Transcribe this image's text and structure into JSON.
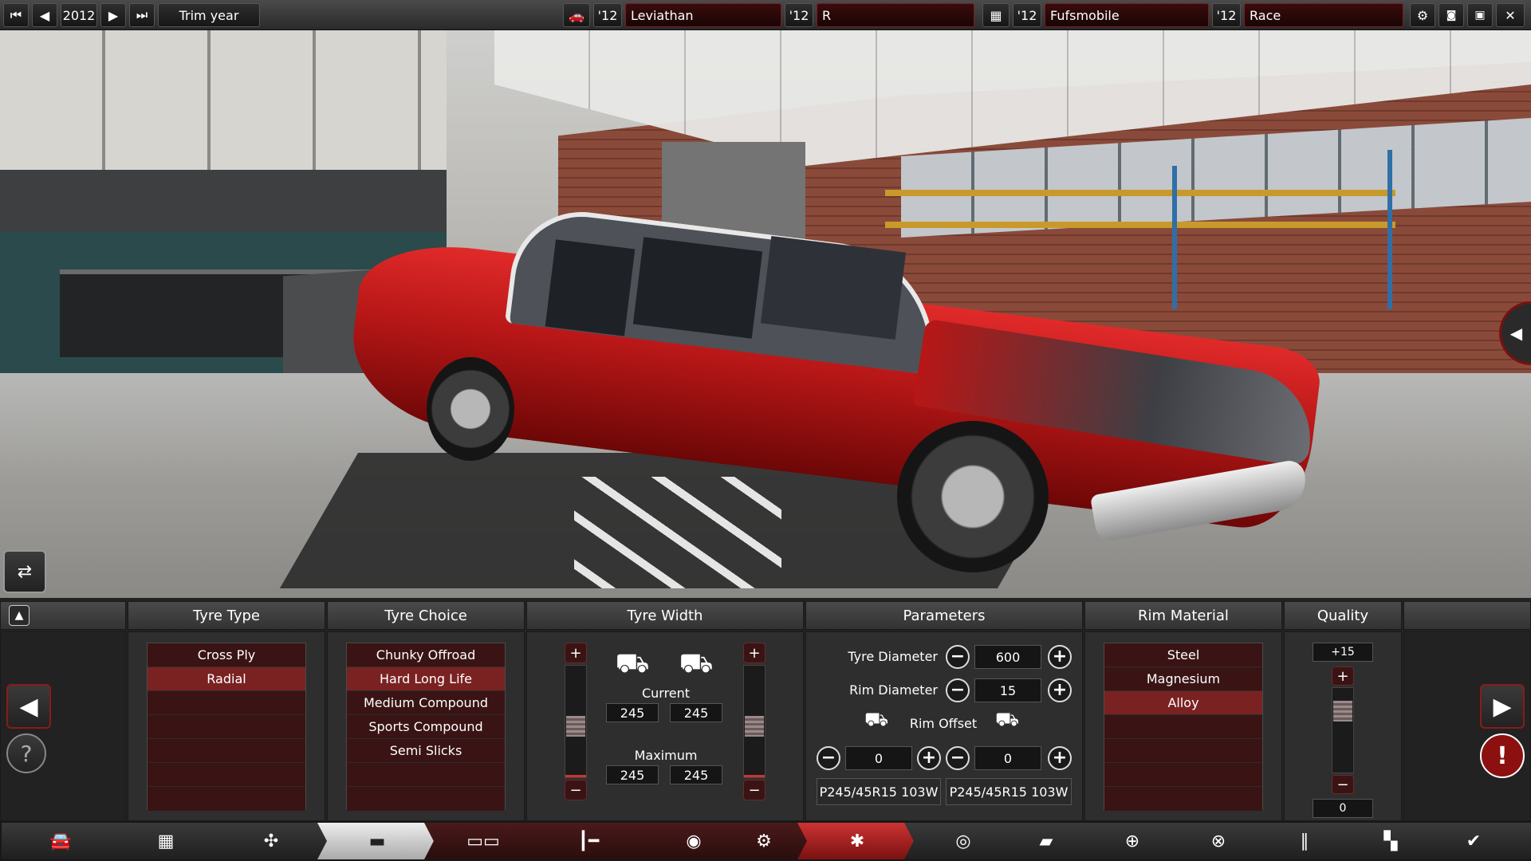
{
  "topbar": {
    "year": "2012",
    "trim_year_label": "Trim year",
    "model_year": "'12",
    "model_name": "Leviathan",
    "trim_year": "'12",
    "trim_name": "R",
    "engine_year": "'12",
    "engine_name": "Fufsmobile",
    "variant_year": "'12",
    "variant_name": "Race"
  },
  "columns": {
    "tyre_type": "Tyre Type",
    "tyre_choice": "Tyre Choice",
    "tyre_width": "Tyre Width",
    "parameters": "Parameters",
    "rim_material": "Rim Material",
    "quality": "Quality"
  },
  "tyre_type": {
    "items": [
      "Cross Ply",
      "Radial"
    ],
    "selected": "Radial"
  },
  "tyre_choice": {
    "items": [
      "Chunky Offroad",
      "Hard Long Life",
      "Medium Compound",
      "Sports Compound",
      "Semi Slicks"
    ],
    "selected": "Hard Long Life"
  },
  "tyre_width": {
    "current_label": "Current",
    "maximum_label": "Maximum",
    "current_front": "245",
    "current_rear": "245",
    "max_front": "245",
    "max_rear": "245",
    "front_slider_level": 0.45,
    "rear_slider_level": 0.45
  },
  "parameters": {
    "tyre_diameter_label": "Tyre Diameter",
    "tyre_diameter": "600",
    "rim_diameter_label": "Rim Diameter",
    "rim_diameter": "15",
    "rim_offset_label": "Rim Offset",
    "rim_offset_front": "0",
    "rim_offset_rear": "0",
    "tyre_code_front": "P245/45R15 103W",
    "tyre_code_rear": "P245/45R15 103W"
  },
  "rim_material": {
    "items": [
      "Steel",
      "Magnesium",
      "Alloy"
    ],
    "selected": "Alloy"
  },
  "quality": {
    "top_value": "+15",
    "bottom_value": "0",
    "slider_level": 0.8
  },
  "icons": {
    "rewind": "⏮",
    "prev": "◀",
    "next": "▶",
    "fast_forward": "⏭",
    "settings": "⚙",
    "camera": "📷",
    "save": "💾",
    "close": "✕",
    "help": "?",
    "warning": "!",
    "check": "✔"
  },
  "colors": {
    "accent_red": "#8c1a1a",
    "selected_row": "#7a2222",
    "row_bg": "#3a1414"
  }
}
